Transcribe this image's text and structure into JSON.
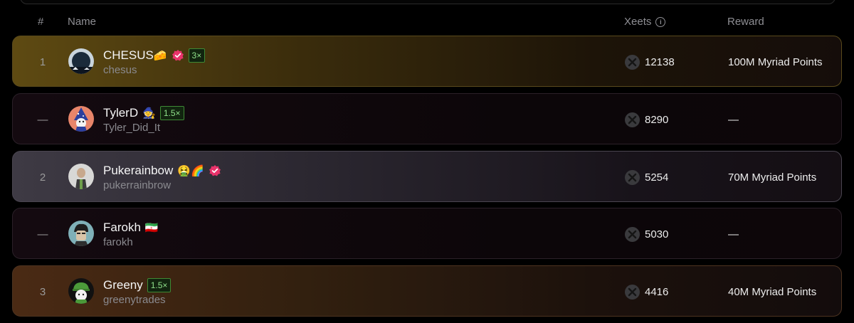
{
  "header": {
    "rank": "#",
    "name": "Name",
    "xeets": "Xeets",
    "xeets_info_icon": "info-icon",
    "reward": "Reward"
  },
  "colors": {
    "gold": "#5e4a12",
    "silver": "#3e3a44",
    "bronze": "#4a2a14",
    "verified": "#e8336b",
    "multiplier": "#8fe08a"
  },
  "rows": [
    {
      "rank": "1",
      "name": "CHESUS",
      "emoji": "🧀",
      "verified": true,
      "multiplier": "3×",
      "handle": "chesus",
      "xeets": "12138",
      "reward": "100M Myriad Points"
    },
    {
      "rank": "—",
      "name": "TylerD",
      "emoji": "🧙",
      "verified": false,
      "multiplier": "1.5×",
      "handle": "Tyler_Did_It",
      "xeets": "8290",
      "reward": "—"
    },
    {
      "rank": "2",
      "name": "Pukerainbow",
      "emoji": "🤮🌈",
      "verified": true,
      "multiplier": "",
      "handle": "pukerrainbrow",
      "xeets": "5254",
      "reward": "70M Myriad Points"
    },
    {
      "rank": "—",
      "name": "Farokh",
      "emoji": "🇮🇷",
      "verified": false,
      "multiplier": "",
      "handle": "farokh",
      "xeets": "5030",
      "reward": "—"
    },
    {
      "rank": "3",
      "name": "Greeny",
      "emoji": "",
      "verified": false,
      "multiplier": "1.5×",
      "handle": "greenytrades",
      "xeets": "4416",
      "reward": "40M Myriad Points"
    }
  ]
}
